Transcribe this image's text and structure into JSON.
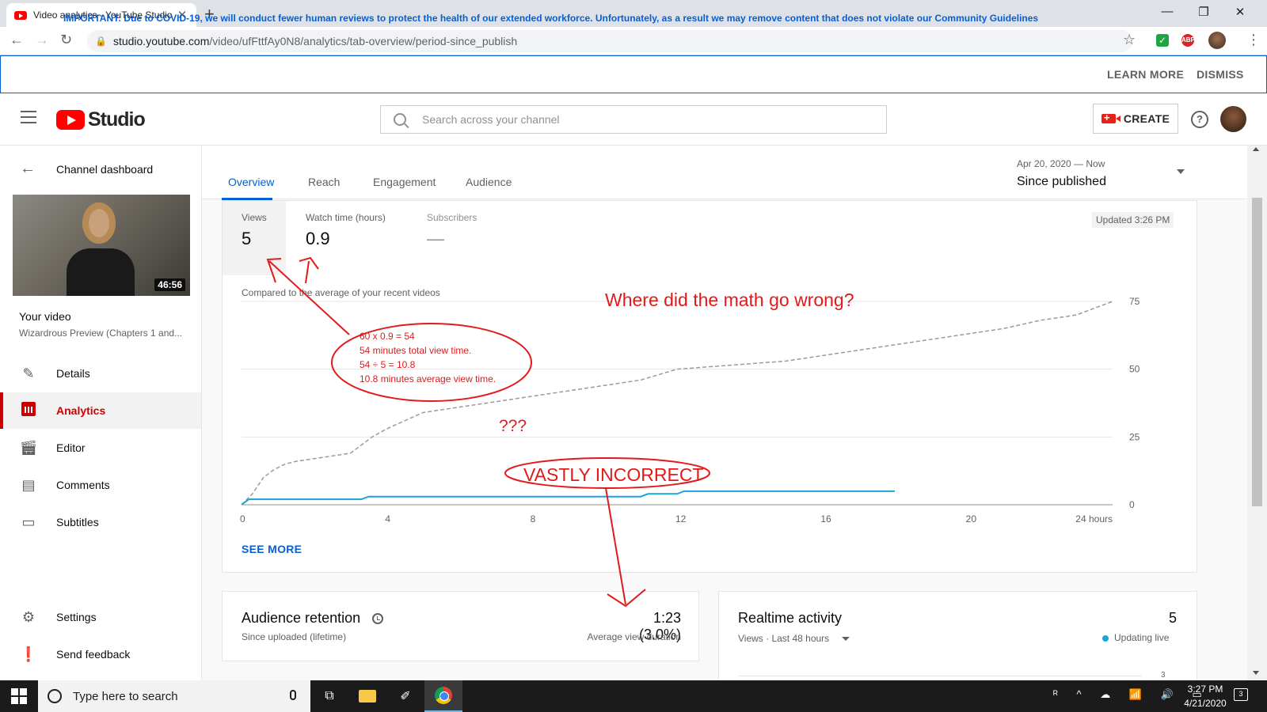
{
  "browser": {
    "tab_title": "Video analytics - YouTube Studio",
    "url_host": "studio.youtube.com",
    "url_path": "/video/ufFttfAy0N8/analytics/tab-overview/period-since_publish"
  },
  "banner": {
    "message": "IMPORTANT: Due to COVID-19, we will conduct fewer human reviews to protect the health of our extended workforce. Unfortunately, as a result we may remove content that does not violate our Community Guidelines",
    "learn_more": "LEARN MORE",
    "dismiss": "DISMISS"
  },
  "header": {
    "brand": "Studio",
    "search_placeholder": "Search across your channel",
    "create_label": "CREATE",
    "help_glyph": "?"
  },
  "sidebar": {
    "back_label": "Channel dashboard",
    "thumbnail_duration": "46:56",
    "your_video_label": "Your video",
    "video_title": "Wizardrous Preview (Chapters 1 and...",
    "items": [
      {
        "label": "Details",
        "icon": "pencil-icon",
        "active": false
      },
      {
        "label": "Analytics",
        "icon": "bar-chart-icon",
        "active": true
      },
      {
        "label": "Editor",
        "icon": "clapperboard-icon",
        "active": false
      },
      {
        "label": "Comments",
        "icon": "comment-icon",
        "active": false
      },
      {
        "label": "Subtitles",
        "icon": "subtitles-icon",
        "active": false
      }
    ],
    "settings_label": "Settings",
    "feedback_label": "Send feedback"
  },
  "tabs": [
    "Overview",
    "Reach",
    "Engagement",
    "Audience"
  ],
  "period": {
    "range": "Apr 20, 2020 — Now",
    "label": "Since published"
  },
  "metrics": [
    {
      "label": "Views",
      "value": "5"
    },
    {
      "label": "Watch time (hours)",
      "value": "0.9"
    },
    {
      "label": "Subscribers",
      "value": "—"
    }
  ],
  "updated": "Updated 3:26 PM",
  "compared_label": "Compared to the average of your recent videos",
  "see_more": "SEE MORE",
  "chart_data": {
    "type": "line",
    "x_ticks": [
      "0",
      "4",
      "8",
      "12",
      "16",
      "20",
      "24 hours"
    ],
    "y_ticks": [
      "0",
      "25",
      "50",
      "75"
    ],
    "xlim": [
      0,
      24
    ],
    "ylim": [
      0,
      75
    ],
    "series": [
      {
        "style": "dashed-gray",
        "x": [
          0,
          0.3,
          0.6,
          0.9,
          1.2,
          1.5,
          2.0,
          2.5,
          3.0,
          3.3,
          3.6,
          4.0,
          4.5,
          5.0,
          5.5,
          6.0,
          7.0,
          8.0,
          9.0,
          10.0,
          11.0,
          12.0,
          13.0,
          14.0,
          15.0,
          16.0,
          17.0,
          18.0,
          19.0,
          20.0,
          21.0,
          22.0,
          23.0,
          24.0
        ],
        "y": [
          0,
          4,
          10,
          13,
          15,
          16,
          17,
          18,
          19,
          22,
          25,
          28,
          31,
          34,
          35,
          36,
          38,
          40,
          42,
          44,
          46,
          50,
          51,
          52,
          53,
          55,
          57,
          59,
          61,
          63,
          65,
          68,
          70,
          75
        ]
      },
      {
        "style": "solid-blue",
        "x": [
          0,
          0.2,
          3.3,
          3.5,
          11.0,
          11.2,
          12.0,
          12.2,
          18.0
        ],
        "y": [
          0,
          2,
          2,
          3,
          3,
          4,
          4,
          5,
          5
        ]
      }
    ]
  },
  "annotations": {
    "math": [
      "60 x 0.9 = 54",
      "54 minutes total view time.",
      "54 ÷ 5 = 10.8",
      "10.8 minutes average view time."
    ],
    "question": "Where did the math go wrong?",
    "qqq": "???",
    "vastly": "VASTLY INCORRECT"
  },
  "retention": {
    "title": "Audience retention",
    "subtitle": "Since uploaded (lifetime)",
    "value": "1:23 (3.0%)",
    "caption": "Average view duration"
  },
  "realtime": {
    "title": "Realtime activity",
    "subtitle": "Views · Last 48 hours",
    "value": "5",
    "live_label": "Updating live",
    "axis_top": "3"
  },
  "taskbar": {
    "search_placeholder": "Type here to search",
    "time": "3:27 PM",
    "date": "4/21/2020",
    "notifications": "3"
  }
}
